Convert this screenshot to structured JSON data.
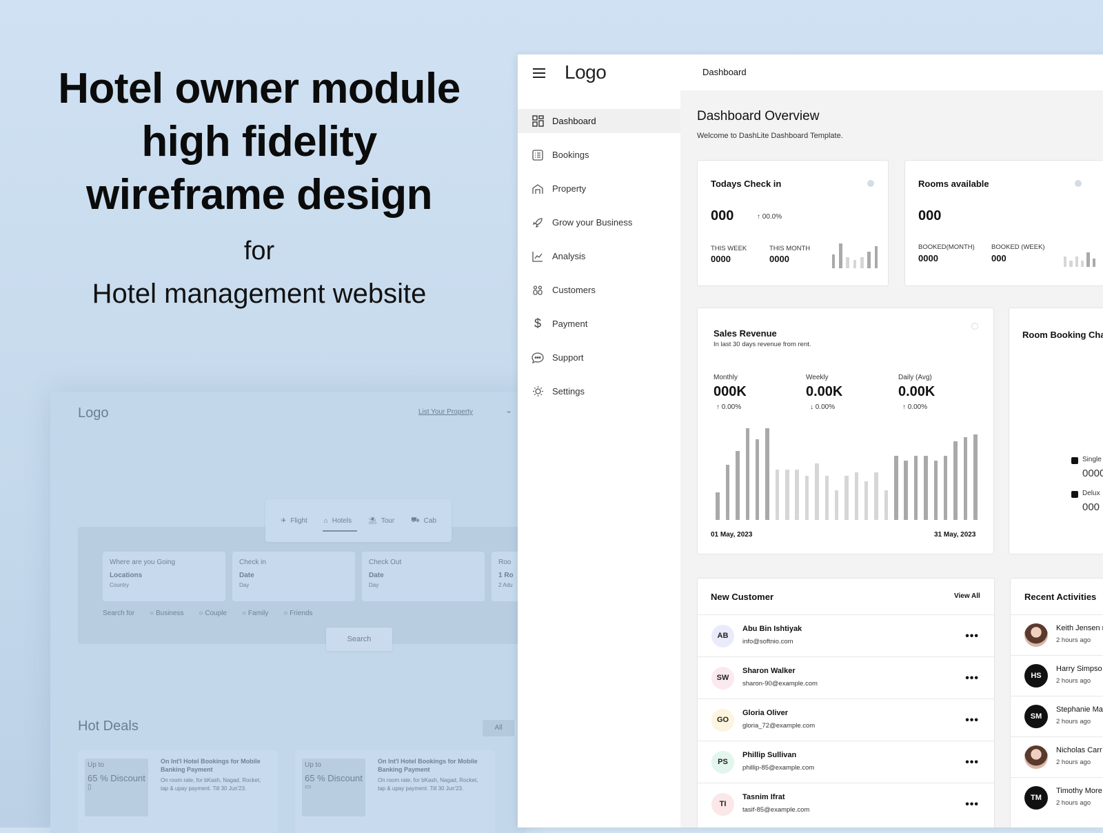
{
  "hero": {
    "line1": "Hotel owner module",
    "line2": "high fidelity",
    "line3": "wireframe design",
    "for": "for",
    "subtitle": "Hotel management website"
  },
  "site": {
    "logo": "Logo",
    "list_property": "List Your Property",
    "tabs": [
      {
        "icon": "plane-icon",
        "label": "Flight"
      },
      {
        "icon": "hotel-icon",
        "label": "Hotels"
      },
      {
        "icon": "tour-icon",
        "label": "Tour"
      },
      {
        "icon": "cab-icon",
        "label": "Cab"
      }
    ],
    "fields": [
      {
        "title": "Where are you Going",
        "value": "Locations",
        "hint": "Country"
      },
      {
        "title": "Check in",
        "value": "Date",
        "hint": "Day"
      },
      {
        "title": "Check Out",
        "value": "Date",
        "hint": "Day"
      },
      {
        "title": "Roo",
        "value": "1 Ro",
        "hint": "2 Adu"
      }
    ],
    "search_for": "Search for",
    "search_options": [
      "Business",
      "Couple",
      "Family",
      "Friends"
    ],
    "search_button": "Search",
    "hot_deals": "Hot Deals",
    "all_button": "All",
    "deals": [
      {
        "upto": "Up to",
        "discount": "65 % Discount",
        "title": "On Int'l Hotel Bookings for Mobile Banking Payment",
        "desc": "On room rate, for bKash, Nagad, Rocket, tap & upay payment. Till 30 Jun'23."
      },
      {
        "upto": "Up to",
        "discount": "65 % Discount",
        "title": "On Int'l Hotel Bookings for Mobile Banking Payment",
        "desc": "On room rate, for bKash, Nagad, Rocket, tap & upay payment. Till 30 Jun'23."
      }
    ]
  },
  "dashboard": {
    "logo": "Logo",
    "breadcrumb": "Dashboard",
    "nav": [
      {
        "icon": "grid-icon",
        "label": "Dashboard"
      },
      {
        "icon": "list-icon",
        "label": "Bookings"
      },
      {
        "icon": "building-icon",
        "label": "Property"
      },
      {
        "icon": "rocket-icon",
        "label": "Grow your Business"
      },
      {
        "icon": "chart-line-icon",
        "label": "Analysis"
      },
      {
        "icon": "users-icon",
        "label": "Customers"
      },
      {
        "icon": "dollar-icon",
        "label": "Payment"
      },
      {
        "icon": "chat-icon",
        "label": "Support"
      },
      {
        "icon": "gear-icon",
        "label": "Settings"
      }
    ],
    "title": "Dashboard Overview",
    "welcome": "Welcome to DashLite Dashboard Template.",
    "checkin": {
      "title": "Todays Check in",
      "value": "000",
      "change": "↑ 00.0%",
      "week_label": "THIS WEEK",
      "week_value": "0000",
      "month_label": "THIS MONTH",
      "month_value": "0000"
    },
    "rooms": {
      "title": "Rooms available",
      "value": "000",
      "month_label": "BOOKED(MONTH)",
      "month_value": "0000",
      "week_label": "BOOKED (WEEK)",
      "week_value": "000"
    },
    "sales": {
      "title": "Sales Revenue",
      "subtitle": "In last 30 days revenue from rent.",
      "stats": [
        {
          "label": "Monthly",
          "value": "000K",
          "change": "↑ 0.00%"
        },
        {
          "label": "Weekly",
          "value": "0.00K",
          "change": "↓ 0.00%"
        },
        {
          "label": "Daily (Avg)",
          "value": "0.00K",
          "change": "↑ 0.00%"
        }
      ],
      "start_date": "01 May, 2023",
      "end_date": "31 May, 2023"
    },
    "room_booking": {
      "title": "Room Booking Cha",
      "legend": [
        {
          "label": "Single",
          "value": "0000"
        },
        {
          "label": "Delux",
          "value": "000"
        }
      ]
    },
    "customers": {
      "title": "New Customer",
      "view_all": "View All",
      "rows": [
        {
          "initials": "AB",
          "name": "Abu Bin Ishtiyak",
          "email": "info@softnio.com",
          "color": "#e9ebfb"
        },
        {
          "initials": "SW",
          "name": "Sharon Walker",
          "email": "sharon-90@example.com",
          "color": "#fbe9f0"
        },
        {
          "initials": "GO",
          "name": "Gloria Oliver",
          "email": "gloria_72@example.com",
          "color": "#fdf4df"
        },
        {
          "initials": "PS",
          "name": "Phillip Sullivan",
          "email": "phillip-85@example.com",
          "color": "#e2f6ee"
        },
        {
          "initials": "TI",
          "name": "Tasnim Ifrat",
          "email": "tasif-85@example.com",
          "color": "#fbe7e7"
        }
      ]
    },
    "activities": {
      "title": "Recent Activities",
      "rows": [
        {
          "initials": "",
          "photo": true,
          "name": "Keith Jensen r",
          "time": "2 hours ago"
        },
        {
          "initials": "HS",
          "photo": false,
          "name": "Harry Simpso",
          "time": "2 hours ago"
        },
        {
          "initials": "SM",
          "photo": false,
          "name": "Stephanie Ma",
          "time": "2 hours ago"
        },
        {
          "initials": "",
          "photo": true,
          "name": "Nicholas Carr",
          "time": "2 hours ago"
        },
        {
          "initials": "TM",
          "photo": false,
          "name": "Timothy More",
          "time": "2 hours ago"
        }
      ]
    }
  },
  "chart_data": [
    {
      "type": "bar",
      "title": "Todays Check in",
      "values": [
        5,
        9,
        4,
        3,
        4,
        6,
        8
      ],
      "ylim": [
        0,
        10
      ]
    },
    {
      "type": "bar",
      "title": "Rooms available",
      "values": [
        5,
        3,
        5,
        3,
        7,
        4
      ],
      "ylim": [
        0,
        10
      ]
    },
    {
      "type": "bar",
      "title": "Sales Revenue",
      "x_start": "01 May, 2023",
      "x_end": "31 May, 2023",
      "values": [
        3,
        6,
        7.5,
        10,
        8.8,
        10,
        5.5,
        5.5,
        5.5,
        4.8,
        6.2,
        4.8,
        3.2,
        4.8,
        5.2,
        4.2,
        5.2,
        3.2,
        7,
        6.5,
        7,
        7,
        6.5,
        7,
        8.6,
        9,
        9.3
      ],
      "highlight": [
        true,
        true,
        true,
        true,
        true,
        true,
        false,
        false,
        false,
        false,
        false,
        false,
        false,
        false,
        false,
        false,
        false,
        false,
        true,
        true,
        true,
        true,
        true,
        true,
        true,
        true,
        true
      ],
      "ylim": [
        0,
        10
      ]
    }
  ]
}
